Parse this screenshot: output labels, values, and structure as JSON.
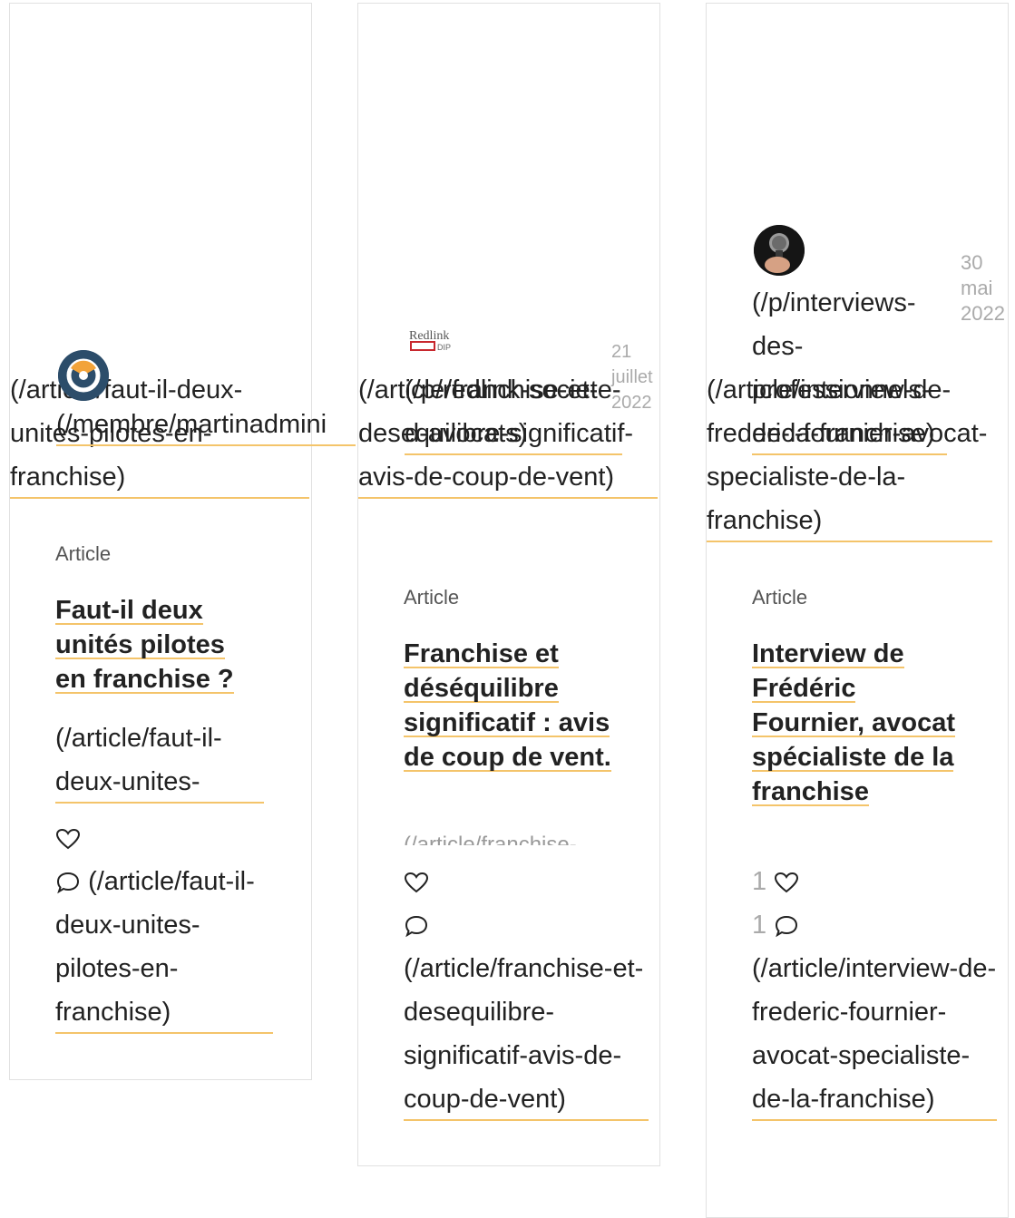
{
  "cards": [
    {
      "image_link": "(/article/faut-il-deux-unites-pilotes-en-franchise)",
      "author_link": "(/membre/martinadmini",
      "avatar_icon": "wheel-logo",
      "date": "",
      "type": "Article",
      "title": "Faut-il deux unités pilotes en franchise ?",
      "title_link": "(/article/faut-il-deux-unites-",
      "likes": "",
      "comments": "",
      "comments_link": "(/article/faut-il-deux-unites-pilotes-en-franchise)"
    },
    {
      "image_link": "(/article/franchise-et-desequilibre-significatif-avis-de-coup-de-vent)",
      "author_link": "(/p/redlink-societe-d-avocats)",
      "avatar_icon": "redlink-dip-logo",
      "logo_text_top": "Redlink",
      "logo_text_bottom": "DIP",
      "date": "21 juillet 2022",
      "type": "Article",
      "title": "Franchise et déséquilibre significatif : avis de coup de vent.",
      "title_link": "(/article/franchise-",
      "likes": "",
      "comments": "",
      "comments_link": "(/article/franchise-et-desequilibre-significatif-avis-de-coup-de-vent)"
    },
    {
      "image_link": "(/article/interview-de-frederic-fournier-avocat-specialiste-de-la-franchise)",
      "author_link": "(/p/interviews-des-professionnels-de-la-franchise)",
      "avatar_icon": "microphone-photo",
      "date": "30 mai 2022",
      "type": "Article",
      "title": "Interview de Frédéric Fournier, avocat spécialiste de la franchise",
      "likes": "1",
      "comments": "1",
      "comments_link": "(/article/interview-de-frederic-fournier-avocat-specialiste-de-la-franchise)"
    }
  ]
}
